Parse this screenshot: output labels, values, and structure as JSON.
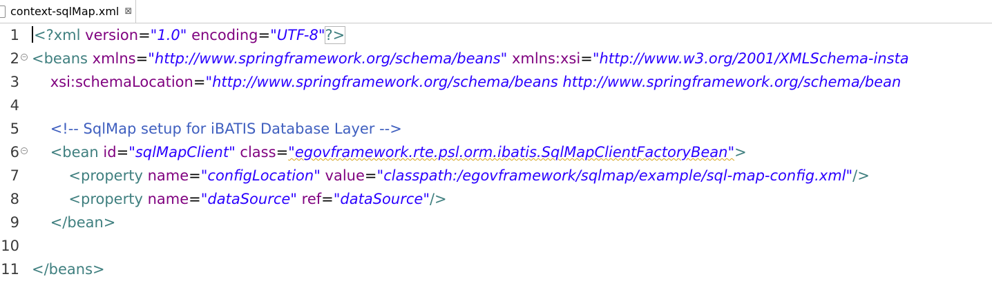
{
  "tab": {
    "label": "context-sqlMap.xml",
    "close": "⊠"
  },
  "lines": [
    {
      "n": "1",
      "t": [
        [
          "<?xml ",
          "tg"
        ],
        [
          "version",
          "an"
        ],
        [
          "=",
          ""
        ],
        [
          "\"1.0\"",
          "av"
        ],
        [
          " ",
          ""
        ],
        [
          "encoding",
          "an"
        ],
        [
          "=",
          ""
        ],
        [
          "\"UTF-8\"",
          "av"
        ],
        [
          "?>",
          "tg"
        ]
      ]
    },
    {
      "n": "2",
      "t": [
        [
          "<beans ",
          "tg"
        ],
        [
          "xmlns",
          "an"
        ],
        [
          "=",
          ""
        ],
        [
          "\"http://www.springframework.org/schema/beans\"",
          "av"
        ],
        [
          " ",
          ""
        ],
        [
          "xmlns:xsi",
          "an"
        ],
        [
          "=",
          ""
        ],
        [
          "\"http://www.w3.org/2001/XMLSchema-insta",
          "av"
        ]
      ]
    },
    {
      "n": "3",
      "t": [
        [
          "    ",
          ""
        ],
        [
          "xsi:schemaLocation",
          "an"
        ],
        [
          "=",
          ""
        ],
        [
          "\"http://www.springframework.org/schema/beans http://www.springframework.org/schema/bean",
          "av"
        ]
      ]
    },
    {
      "n": "4",
      "t": []
    },
    {
      "n": "5",
      "t": [
        [
          "    ",
          ""
        ],
        [
          "<!-- SqlMap setup for iBATIS Database Layer -->",
          "cm"
        ]
      ]
    },
    {
      "n": "6",
      "t": [
        [
          "    ",
          ""
        ],
        [
          "<bean ",
          "tg"
        ],
        [
          "id",
          "an"
        ],
        [
          "=",
          ""
        ],
        [
          "\"sqlMapClient\"",
          "av"
        ],
        [
          " ",
          ""
        ],
        [
          "class",
          "an"
        ],
        [
          "=",
          ""
        ],
        [
          "\"egovframework.rte.psl.orm.ibatis.SqlMapClientFactoryBean\"",
          "av"
        ],
        [
          ">",
          "tg"
        ]
      ]
    },
    {
      "n": "7",
      "t": [
        [
          "        ",
          ""
        ],
        [
          "<property ",
          "tg"
        ],
        [
          "name",
          "an"
        ],
        [
          "=",
          ""
        ],
        [
          "\"configLocation\"",
          "av"
        ],
        [
          " ",
          ""
        ],
        [
          "value",
          "an"
        ],
        [
          "=",
          ""
        ],
        [
          "\"classpath:/egovframework/sqlmap/example/sql-map-config.xml\"",
          "av"
        ],
        [
          "/>",
          "tg"
        ]
      ]
    },
    {
      "n": "8",
      "t": [
        [
          "        ",
          ""
        ],
        [
          "<property ",
          "tg"
        ],
        [
          "name",
          "an"
        ],
        [
          "=",
          ""
        ],
        [
          "\"dataSource\"",
          "av"
        ],
        [
          " ",
          ""
        ],
        [
          "ref",
          "an"
        ],
        [
          "=",
          ""
        ],
        [
          "\"dataSource\"",
          "av"
        ],
        [
          "/>",
          "tg"
        ]
      ]
    },
    {
      "n": "9",
      "t": [
        [
          "    ",
          ""
        ],
        [
          "</bean>",
          "tg"
        ]
      ]
    },
    {
      "n": "10",
      "t": []
    },
    {
      "n": "11",
      "t": [
        [
          "</beans>",
          "tg"
        ]
      ]
    }
  ],
  "foldable_lines": [
    "2",
    "6"
  ],
  "colors": {
    "tag": "#3f7f7f",
    "attribute": "#7f007f",
    "value": "#2a00ff",
    "comment": "#3f5fbf"
  }
}
